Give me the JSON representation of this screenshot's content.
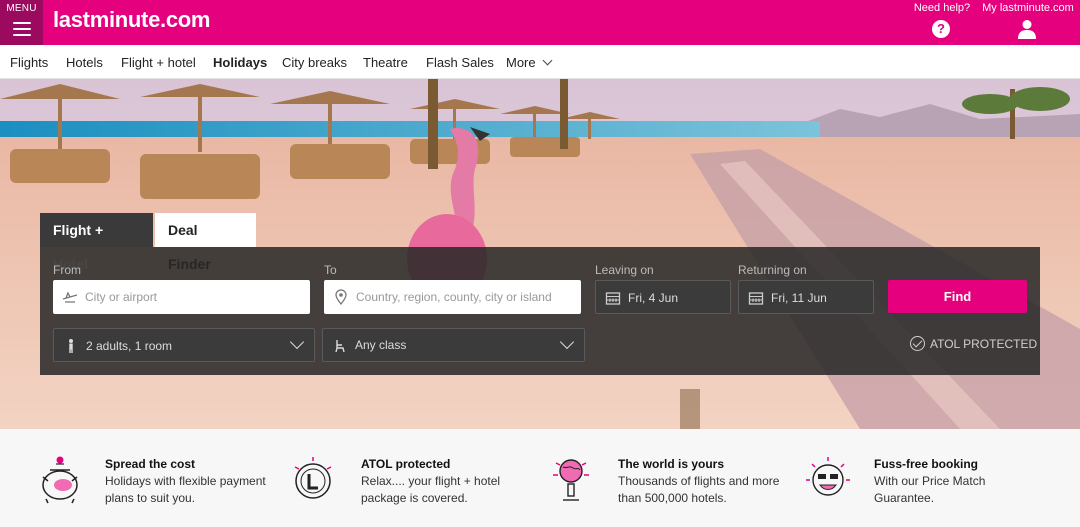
{
  "header": {
    "menu_label": "MENU",
    "logo": "lastminute.com",
    "help_label": "Need help?",
    "account_label": "My lastminute.com",
    "brand_color": "#e5007d"
  },
  "nav": {
    "items": [
      {
        "label": "Flights"
      },
      {
        "label": "Hotels"
      },
      {
        "label": "Flight + hotel"
      },
      {
        "label": "Holidays",
        "active": true
      },
      {
        "label": "City breaks"
      },
      {
        "label": "Theatre"
      },
      {
        "label": "Flash Sales"
      },
      {
        "label": "More"
      }
    ]
  },
  "search": {
    "tabs": [
      "Flight + Hotel",
      "Deal Finder"
    ],
    "from": {
      "label": "From",
      "placeholder": "City or airport"
    },
    "to": {
      "label": "To",
      "placeholder": "Country, region, county, city or island"
    },
    "leaving": {
      "label": "Leaving on",
      "value": "Fri, 4 Jun"
    },
    "returning": {
      "label": "Returning on",
      "value": "Fri, 11 Jun"
    },
    "find_label": "Find",
    "travellers": "2 adults, 1 room",
    "cabin_class": "Any class",
    "atol_label": "ATOL PROTECTED"
  },
  "benefits": [
    {
      "icon": "piggy-pot-icon",
      "title": "Spread the cost",
      "text": "Holidays with flexible payment plans to suit you."
    },
    {
      "icon": "atol-badge-icon",
      "title": "ATOL protected",
      "text": "Relax.... your flight + hotel package is covered."
    },
    {
      "icon": "globe-icon",
      "title": "The world is yours",
      "text": "Thousands of flights and more than 500,000 hotels."
    },
    {
      "icon": "happy-face-icon",
      "title": "Fuss-free booking",
      "text": "With our Price Match Guarantee."
    }
  ]
}
